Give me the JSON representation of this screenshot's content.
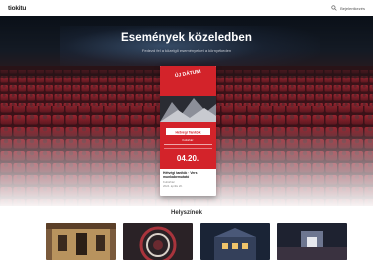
{
  "header": {
    "logo": "tiokitu",
    "account_label": "Bejelentkezés"
  },
  "hero": {
    "title": "Események közeledben",
    "subtitle": "Fedezd fel a közelgő eseményeket a környékeden"
  },
  "featured_event": {
    "badge": "ÚJ DÁTUM",
    "poster_heading": "Hétvégi Tanítók",
    "poster_tagline": "Kultúrház",
    "poster_date": "04.20.",
    "title": "Hétvégi tanítók · Vers munkabemutató",
    "venue": "Kultúrház",
    "date": "2024. április 20."
  },
  "venues_section": {
    "heading": "Helyszínek"
  },
  "colors": {
    "accent_red": "#d3232a",
    "hero_dark": "#141a24",
    "seat_red": "#8a1f28"
  },
  "icons": {
    "search": "search-icon",
    "user": "user-icon"
  }
}
